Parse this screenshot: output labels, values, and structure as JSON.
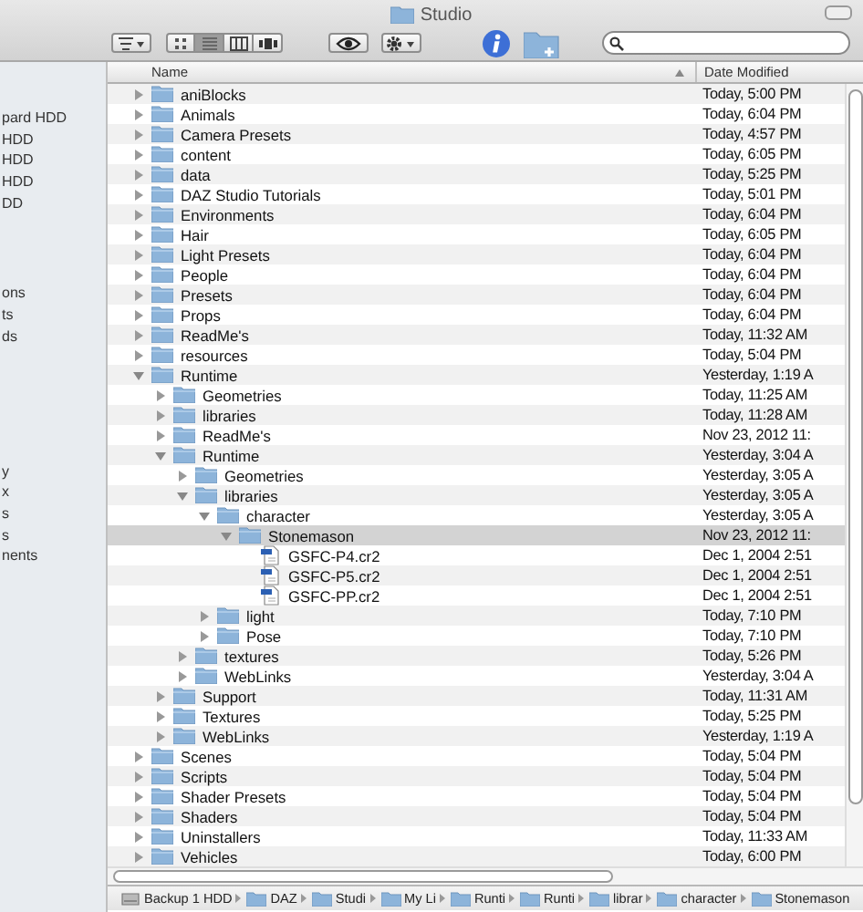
{
  "window": {
    "title": "Studio"
  },
  "toolbar": {
    "view_modes": [
      {
        "kind": "icons",
        "selected": false
      },
      {
        "kind": "list",
        "selected": true
      },
      {
        "kind": "columns",
        "selected": false
      },
      {
        "kind": "coverflow",
        "selected": false
      }
    ]
  },
  "sidebar": {
    "groups": [
      [
        "pard HDD",
        "HDD",
        "HDD",
        "HDD",
        "DD"
      ],
      [
        "ons",
        "ts",
        "ds"
      ],
      [
        "y",
        "x",
        "s",
        "s",
        "nents"
      ]
    ]
  },
  "list": {
    "columns": [
      "Name",
      "Date Modified"
    ],
    "rows": [
      {
        "name": "aniBlocks",
        "date": "Today, 5:00 PM",
        "kind": "folder",
        "expanded": false,
        "selected": false
      },
      {
        "name": "Animals",
        "date": "Today, 6:04 PM",
        "kind": "folder",
        "expanded": false,
        "selected": false
      },
      {
        "name": "Camera Presets",
        "date": "Today, 4:57 PM",
        "kind": "folder",
        "expanded": false,
        "selected": false
      },
      {
        "name": "content",
        "date": "Today, 6:05 PM",
        "kind": "folder",
        "expanded": false,
        "selected": false
      },
      {
        "name": "data",
        "date": "Today, 5:25 PM",
        "kind": "folder",
        "expanded": false,
        "selected": false
      },
      {
        "name": "DAZ Studio Tutorials",
        "date": "Today, 5:01 PM",
        "kind": "folder",
        "expanded": false,
        "selected": false
      },
      {
        "name": "Environments",
        "date": "Today, 6:04 PM",
        "kind": "folder",
        "expanded": false,
        "selected": false
      },
      {
        "name": "Hair",
        "date": "Today, 6:05 PM",
        "kind": "folder",
        "expanded": false,
        "selected": false
      },
      {
        "name": "Light Presets",
        "date": "Today, 6:04 PM",
        "kind": "folder",
        "expanded": false,
        "selected": false
      },
      {
        "name": "People",
        "date": "Today, 6:04 PM",
        "kind": "folder",
        "expanded": false,
        "selected": false
      },
      {
        "name": "Presets",
        "date": "Today, 6:04 PM",
        "kind": "folder",
        "expanded": false,
        "selected": false
      },
      {
        "name": "Props",
        "date": "Today, 6:04 PM",
        "kind": "folder",
        "expanded": false,
        "selected": false
      },
      {
        "name": "ReadMe's",
        "date": "Today, 11:32 AM",
        "kind": "folder",
        "expanded": false,
        "selected": false
      },
      {
        "name": "resources",
        "date": "Today, 5:04 PM",
        "kind": "folder",
        "expanded": false,
        "selected": false
      },
      {
        "name": "Runtime",
        "date": "Yesterday, 1:19 A",
        "kind": "folder",
        "expanded": true,
        "selected": false,
        "children": [
          {
            "name": "Geometries",
            "date": "Today, 11:25 AM",
            "kind": "folder",
            "expanded": false,
            "selected": false
          },
          {
            "name": "libraries",
            "date": "Today, 11:28 AM",
            "kind": "folder",
            "expanded": false,
            "selected": false
          },
          {
            "name": "ReadMe's",
            "date": "Nov 23, 2012 11:",
            "kind": "folder",
            "expanded": false,
            "selected": false
          },
          {
            "name": "Runtime",
            "date": "Yesterday, 3:04 A",
            "kind": "folder",
            "expanded": true,
            "selected": false,
            "children": [
              {
                "name": "Geometries",
                "date": "Yesterday, 3:05 A",
                "kind": "folder",
                "expanded": false,
                "selected": false
              },
              {
                "name": "libraries",
                "date": "Yesterday, 3:05 A",
                "kind": "folder",
                "expanded": true,
                "selected": false,
                "children": [
                  {
                    "name": "character",
                    "date": "Yesterday, 3:05 A",
                    "kind": "folder",
                    "expanded": true,
                    "selected": false,
                    "children": [
                      {
                        "name": "Stonemason",
                        "date": "Nov 23, 2012 11:",
                        "kind": "folder",
                        "expanded": true,
                        "selected": true,
                        "children": [
                          {
                            "name": "GSFC-P4.cr2",
                            "date": "Dec 1, 2004 2:51",
                            "kind": "file",
                            "selected": false
                          },
                          {
                            "name": "GSFC-P5.cr2",
                            "date": "Dec 1, 2004 2:51",
                            "kind": "file",
                            "selected": false
                          },
                          {
                            "name": "GSFC-PP.cr2",
                            "date": "Dec 1, 2004 2:51",
                            "kind": "file",
                            "selected": false
                          }
                        ]
                      }
                    ]
                  },
                  {
                    "name": "light",
                    "date": "Today, 7:10 PM",
                    "kind": "folder",
                    "expanded": false,
                    "selected": false
                  },
                  {
                    "name": "Pose",
                    "date": "Today, 7:10 PM",
                    "kind": "folder",
                    "expanded": false,
                    "selected": false
                  }
                ]
              },
              {
                "name": "textures",
                "date": "Today, 5:26 PM",
                "kind": "folder",
                "expanded": false,
                "selected": false
              },
              {
                "name": "WebLinks",
                "date": "Yesterday, 3:04 A",
                "kind": "folder",
                "expanded": false,
                "selected": false
              }
            ]
          },
          {
            "name": "Support",
            "date": "Today, 11:31 AM",
            "kind": "folder",
            "expanded": false,
            "selected": false
          },
          {
            "name": "Textures",
            "date": "Today, 5:25 PM",
            "kind": "folder",
            "expanded": false,
            "selected": false
          },
          {
            "name": "WebLinks",
            "date": "Yesterday, 1:19 A",
            "kind": "folder",
            "expanded": false,
            "selected": false
          }
        ]
      },
      {
        "name": "Scenes",
        "date": "Today, 5:04 PM",
        "kind": "folder",
        "expanded": false,
        "selected": false
      },
      {
        "name": "Scripts",
        "date": "Today, 5:04 PM",
        "kind": "folder",
        "expanded": false,
        "selected": false
      },
      {
        "name": "Shader Presets",
        "date": "Today, 5:04 PM",
        "kind": "folder",
        "expanded": false,
        "selected": false
      },
      {
        "name": "Shaders",
        "date": "Today, 5:04 PM",
        "kind": "folder",
        "expanded": false,
        "selected": false
      },
      {
        "name": "Uninstallers",
        "date": "Today, 11:33 AM",
        "kind": "folder",
        "expanded": false,
        "selected": false
      },
      {
        "name": "Vehicles",
        "date": "Today, 6:00 PM",
        "kind": "folder",
        "expanded": false,
        "selected": false
      }
    ]
  },
  "path_bar": [
    {
      "label": "Backup 1 HDD",
      "kind": "disk"
    },
    {
      "label": "DAZ",
      "kind": "folder"
    },
    {
      "label": "Studi",
      "kind": "folder"
    },
    {
      "label": "My Li",
      "kind": "folder"
    },
    {
      "label": "Runti",
      "kind": "folder"
    },
    {
      "label": "Runti",
      "kind": "folder"
    },
    {
      "label": "librar",
      "kind": "folder"
    },
    {
      "label": "character",
      "kind": "folder"
    },
    {
      "label": "Stonemason",
      "kind": "folder"
    }
  ]
}
